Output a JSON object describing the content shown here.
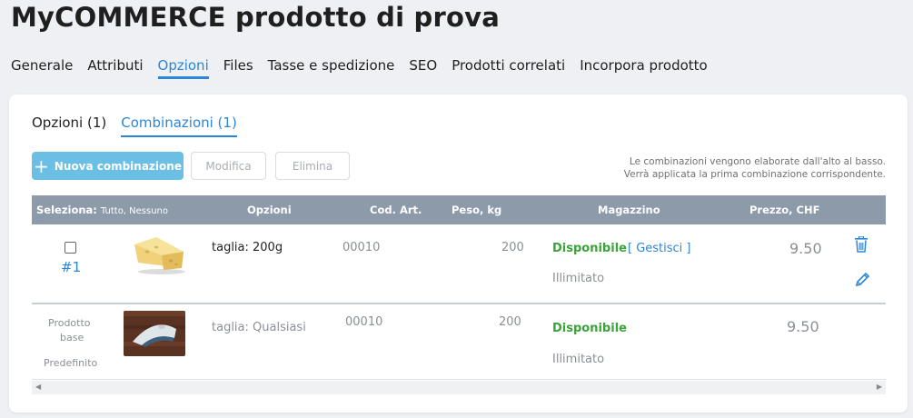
{
  "page": {
    "title": "MyCOMMERCE prodotto di prova"
  },
  "main_tabs": [
    {
      "label": "Generale"
    },
    {
      "label": "Attributi"
    },
    {
      "label": "Opzioni",
      "active": true
    },
    {
      "label": "Files"
    },
    {
      "label": "Tasse e spedizione"
    },
    {
      "label": "SEO"
    },
    {
      "label": "Prodotti correlati"
    },
    {
      "label": "Incorpora prodotto"
    }
  ],
  "sub_tabs": [
    {
      "label": "Opzioni (1)"
    },
    {
      "label": "Combinazioni (1)",
      "active": true
    }
  ],
  "toolbar": {
    "new_label": "Nuova combinazione",
    "edit_label": "Modifica",
    "delete_label": "Elimina",
    "info_line1": "Le combinazioni vengono elaborate dall'alto al basso.",
    "info_line2": "Verrà applicata la prima combinazione corrispondente."
  },
  "table": {
    "select_label": "Seleziona:",
    "select_options": "Tutto, Nessuno",
    "headers": {
      "options": "Opzioni",
      "sku": "Cod. Art.",
      "weight": "Peso, kg",
      "stock": "Magazzino",
      "price": "Prezzo, CHF"
    },
    "rows": [
      {
        "index": "#1",
        "option": "taglia: 200g",
        "sku": "00010",
        "weight": "200",
        "stock_status": "Disponibile",
        "manage": "[ Gestisci ]",
        "stock_qty": "Illimitato",
        "price": "9.50"
      },
      {
        "base_line1": "Prodotto",
        "base_line2": "base",
        "default": "Predefinito",
        "option": "taglia: Qualsiasi",
        "sku": "00010",
        "weight": "200",
        "stock_status": "Disponibile",
        "stock_qty": "Illimitato",
        "price": "9.50"
      }
    ]
  },
  "colors": {
    "accent": "#2b86d9",
    "header_bg": "#8d9aaa",
    "available": "#3aa33a",
    "button_primary": "#6cbfe4"
  },
  "icons": [
    "plus-icon",
    "trash-icon",
    "pencil-icon",
    "cheese-image",
    "scroll-left-icon",
    "scroll-right-icon"
  ]
}
